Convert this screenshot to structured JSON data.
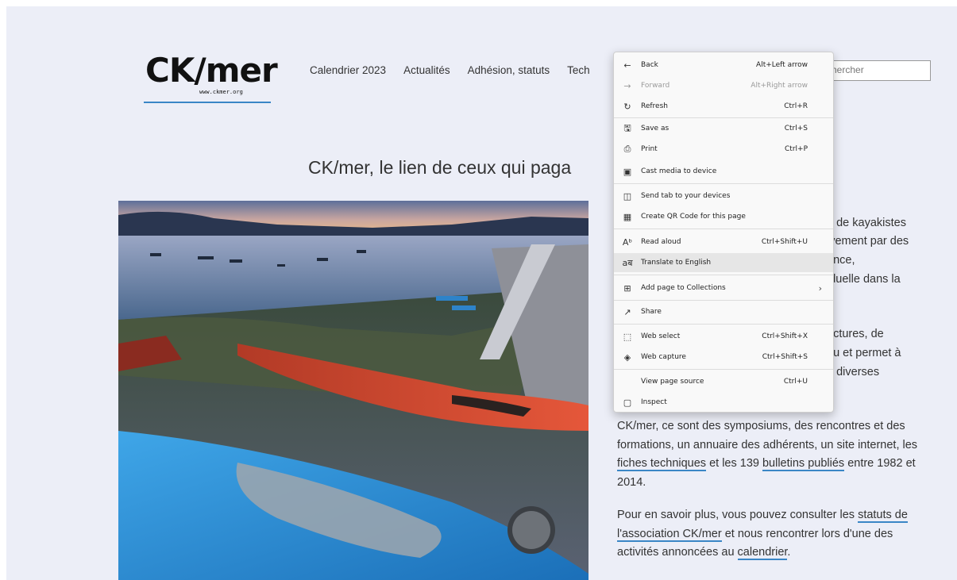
{
  "logo": {
    "text": "CK/mer",
    "url_text": "www.ckmer.org"
  },
  "nav": [
    "Calendrier 2023",
    "Actualités",
    "Adhésion, statuts",
    "Tech"
  ],
  "search": {
    "placeholder": "chercher"
  },
  "headline": "CK/mer, le lien de ceux qui paga",
  "right_fragments": [
    "e de kayakistes",
    "ivement par des",
    "ance,",
    "iduelle dans la",
    "uctures, de",
    "au et permet à",
    "e diverses"
  ],
  "paragraph1": {
    "before": "CK/mer, ce sont des symposiums, des rencontres et des formations, un annuaire des adhérents, un site internet, les ",
    "link1": "fiches techniques",
    "middle": " et les 139 ",
    "link2": "bulletins publiés",
    "after": " entre 1982 et 2014."
  },
  "paragraph2": {
    "before": "Pour en savoir plus, vous pouvez consulter les ",
    "link1": "statuts de l'association CK/mer",
    "middle": " et nous rencontrer lors d'une des activités annoncées au ",
    "link2": "calendrier",
    "after": "."
  },
  "context_menu": {
    "items": [
      {
        "label": "Back",
        "shortcut": "Alt+Left arrow",
        "icon": "back-arrow-icon"
      },
      {
        "label": "Forward",
        "shortcut": "Alt+Right arrow",
        "icon": "forward-arrow-icon",
        "disabled": true
      },
      {
        "label": "Refresh",
        "shortcut": "Ctrl+R",
        "icon": "refresh-icon"
      },
      {
        "label": "Save as",
        "shortcut": "Ctrl+S",
        "icon": "save-as-icon"
      },
      {
        "label": "Print",
        "shortcut": "Ctrl+P",
        "icon": "print-icon"
      },
      {
        "label": "Cast media to device",
        "shortcut": "",
        "icon": "cast-icon"
      },
      {
        "label": "Send tab to your devices",
        "shortcut": "",
        "icon": "send-tab-icon"
      },
      {
        "label": "Create QR Code for this page",
        "shortcut": "",
        "icon": "qr-code-icon"
      },
      {
        "label": "Read aloud",
        "shortcut": "Ctrl+Shift+U",
        "icon": "read-aloud-icon"
      },
      {
        "label": "Translate to English",
        "shortcut": "",
        "icon": "translate-icon"
      },
      {
        "label": "Add page to Collections",
        "shortcut": "",
        "icon": "collections-icon"
      },
      {
        "label": "Share",
        "shortcut": "",
        "icon": "share-icon"
      },
      {
        "label": "Web select",
        "shortcut": "Ctrl+Shift+X",
        "icon": "web-select-icon"
      },
      {
        "label": "Web capture",
        "shortcut": "Ctrl+Shift+S",
        "icon": "web-capture-icon"
      },
      {
        "label": "View page source",
        "shortcut": "Ctrl+U",
        "icon": ""
      },
      {
        "label": "Inspect",
        "shortcut": "",
        "icon": "inspect-icon"
      }
    ],
    "hovered_item": "Translate to English"
  },
  "colors": {
    "page_bg": "#eceef7",
    "accent": "#3a86c6",
    "menu_bg": "#f9f9f9"
  }
}
